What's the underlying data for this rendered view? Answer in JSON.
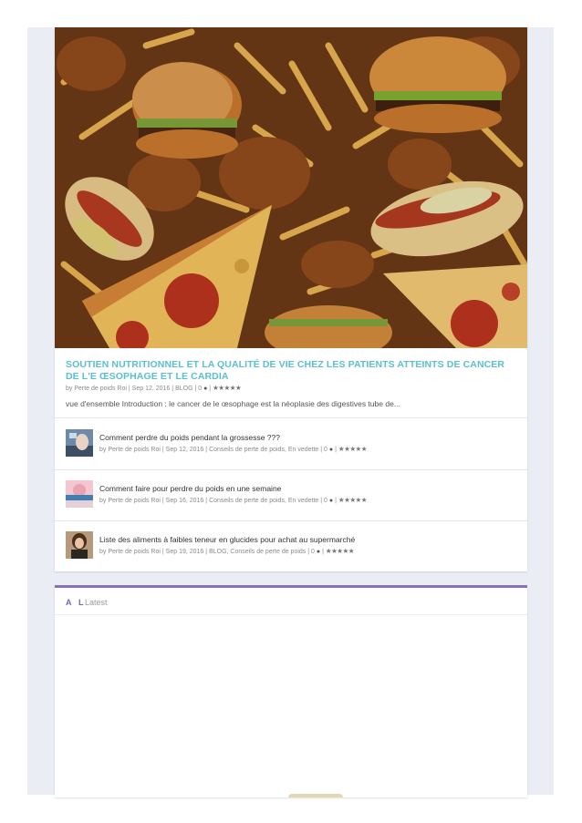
{
  "featured": {
    "title": "SOUTIEN NUTRITIONNEL ET LA QUALITÉ DE VIE CHEZ LES PATIENTS ATTEINTS DE CANCER DE L'E ŒSOPHAGE ET LE CARDIA",
    "meta": {
      "author_prefix": "by Perte de poids Roi",
      "date": "Sep 12, 2016",
      "category": "BLOG",
      "comments": "0",
      "rating": "★★★★★"
    },
    "excerpt": "vue d'ensemble Introduction : le cancer de le œsophage est la néoplasie des digestives tube de..."
  },
  "list": [
    {
      "title": "Comment perdre du poids pendant la grossesse ???",
      "author": "by Perte de poids Roi",
      "date": "Sep 12, 2016",
      "categories": "Conseils de perte de poids, En vedette",
      "comments": "0",
      "rating": "★★★★★"
    },
    {
      "title": "Comment faire pour perdre du poids en une semaine",
      "author": "by Perte de poids Roi",
      "date": "Sep 16, 2016",
      "categories": "Conseils de perte de poids, En vedette",
      "comments": "0",
      "rating": "★★★★★"
    },
    {
      "title": "Liste des aliments à faibles teneur en glucides pour achat au supermarché",
      "author": "by Perte de poids Roi",
      "date": "Sep 19, 2016",
      "categories": "BLOG, Conseils de perte de poids",
      "comments": "0",
      "rating": "★★★★★"
    }
  ],
  "tabs": {
    "a": "A",
    "l": "L",
    "latest": "Latest"
  },
  "sep": "|",
  "icons": {
    "comment": "comment-bubble-icon",
    "star": "star-icon"
  },
  "colors": {
    "title_accent": "#5bbfcf",
    "tab_accent": "#8a70c4",
    "page_bg": "#eaeef4"
  }
}
